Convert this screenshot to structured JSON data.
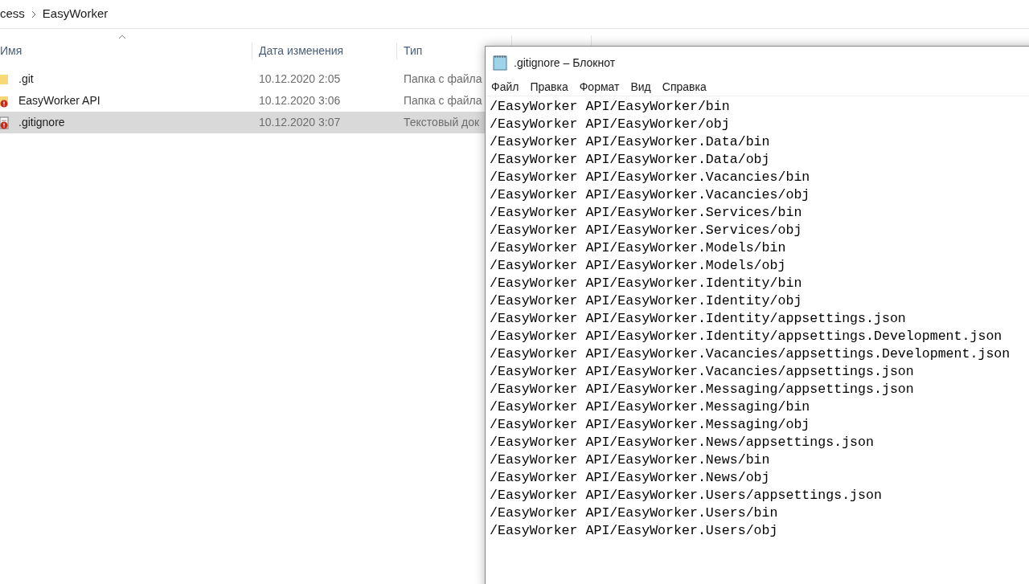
{
  "breadcrumb": [
    "cess",
    "EasyWorker"
  ],
  "columns": [
    "Имя",
    "Дата изменения",
    "Тип"
  ],
  "files": [
    {
      "kind": "folder",
      "name": ".git",
      "date": "10.12.2020 2:05",
      "type": "Папка с файла",
      "selected": false
    },
    {
      "kind": "folder-error",
      "name": "EasyWorker API",
      "date": "10.12.2020 3:06",
      "type": "Папка с файла",
      "selected": false
    },
    {
      "kind": "file-error",
      "name": ".gitignore",
      "date": "10.12.2020 3:07",
      "type": "Текстовый док",
      "selected": true
    }
  ],
  "notepad": {
    "title": ".gitignore – Блокнот",
    "menu": [
      "Файл",
      "Правка",
      "Формат",
      "Вид",
      "Справка"
    ],
    "lines": [
      "/EasyWorker API/EasyWorker/bin",
      "/EasyWorker API/EasyWorker/obj",
      "/EasyWorker API/EasyWorker.Data/bin",
      "/EasyWorker API/EasyWorker.Data/obj",
      "/EasyWorker API/EasyWorker.Vacancies/bin",
      "/EasyWorker API/EasyWorker.Vacancies/obj",
      "/EasyWorker API/EasyWorker.Services/bin",
      "/EasyWorker API/EasyWorker.Services/obj",
      "/EasyWorker API/EasyWorker.Models/bin",
      "/EasyWorker API/EasyWorker.Models/obj",
      "/EasyWorker API/EasyWorker.Identity/bin",
      "/EasyWorker API/EasyWorker.Identity/obj",
      "/EasyWorker API/EasyWorker.Identity/appsettings.json",
      "/EasyWorker API/EasyWorker.Identity/appsettings.Development.json",
      "/EasyWorker API/EasyWorker.Vacancies/appsettings.Development.json",
      "/EasyWorker API/EasyWorker.Vacancies/appsettings.json",
      "/EasyWorker API/EasyWorker.Messaging/appsettings.json",
      "/EasyWorker API/EasyWorker.Messaging/bin",
      "/EasyWorker API/EasyWorker.Messaging/obj",
      "/EasyWorker API/EasyWorker.News/appsettings.json",
      "/EasyWorker API/EasyWorker.News/bin",
      "/EasyWorker API/EasyWorker.News/obj",
      "/EasyWorker API/EasyWorker.Users/appsettings.json",
      "/EasyWorker API/EasyWorker.Users/bin",
      "/EasyWorker API/EasyWorker.Users/obj"
    ]
  }
}
